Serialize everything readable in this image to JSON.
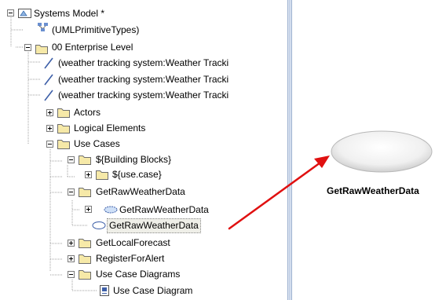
{
  "tree": {
    "items": [
      {
        "label": "Systems Model *"
      },
      {
        "label": "(UMLPrimitiveTypes)"
      },
      {
        "label": "00 Enterprise Level"
      },
      {
        "label": "(weather tracking system:Weather Tracki"
      },
      {
        "label": "(weather tracking system:Weather Tracki"
      },
      {
        "label": "(weather tracking system:Weather Tracki"
      },
      {
        "label": "Actors"
      },
      {
        "label": "Logical Elements"
      },
      {
        "label": "Use Cases"
      },
      {
        "label": "${Building Blocks}"
      },
      {
        "label": "${use.case}"
      },
      {
        "label": "GetRawWeatherData"
      },
      {
        "label": "GetRawWeatherData"
      },
      {
        "label": "GetRawWeatherData"
      },
      {
        "label": "GetLocalForecast"
      },
      {
        "label": "RegisterForAlert"
      },
      {
        "label": "Use Case Diagrams"
      },
      {
        "label": "Use Case Diagram"
      }
    ]
  },
  "diagram": {
    "use_case_label": "GetRawWeatherData"
  },
  "colors": {
    "arrow": "#e01010",
    "folder": "#f6e9a8",
    "folder_border": "#6d6d6d",
    "tree_line": "#a0a0a0",
    "splitter": "#dfe7f3"
  },
  "icons": {
    "expanded": "minus-box-icon",
    "collapsed": "plus-box-icon",
    "folder": "folder-icon",
    "model": "model-icon",
    "association": "association-line-icon",
    "use_case": "use-case-ellipse-icon",
    "diagram": "diagram-icon"
  }
}
